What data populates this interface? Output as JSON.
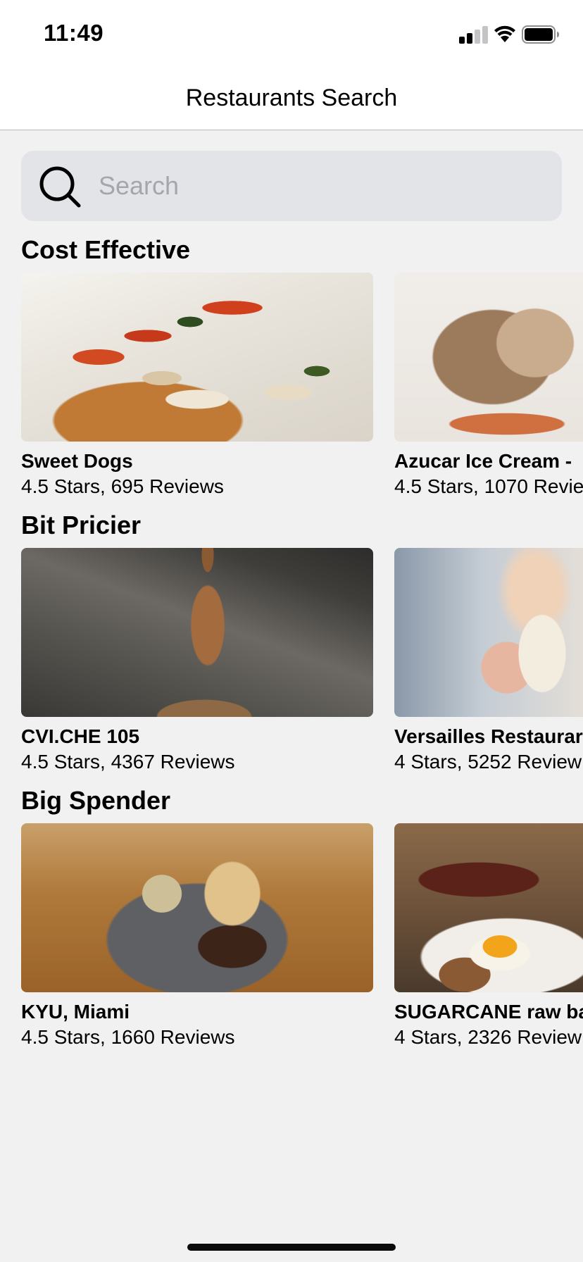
{
  "status_bar": {
    "time": "11:49",
    "icons": [
      "signal-icon",
      "wifi-icon",
      "battery-icon"
    ]
  },
  "nav": {
    "title": "Restaurants Search"
  },
  "search": {
    "placeholder": "Search",
    "value": "",
    "icon": "search-icon"
  },
  "sections": [
    {
      "title": "Cost Effective",
      "cards": [
        {
          "name": "Sweet Dogs",
          "meta": "4.5 Stars, 695 Reviews"
        },
        {
          "name": "Azucar Ice Cream -",
          "meta": "4.5 Stars, 1070 Revie"
        }
      ]
    },
    {
      "title": "Bit Pricier",
      "cards": [
        {
          "name": "CVI.CHE 105",
          "meta": "4.5 Stars, 4367 Reviews"
        },
        {
          "name": "Versailles Restaurar",
          "meta": "4 Stars, 5252 Review"
        }
      ]
    },
    {
      "title": "Big Spender",
      "cards": [
        {
          "name": "KYU, Miami",
          "meta": "4.5 Stars, 1660 Reviews"
        },
        {
          "name": "SUGARCANE raw ba",
          "meta": "4 Stars, 2326 Review"
        }
      ]
    }
  ],
  "colors": {
    "background": "#f1f1f2",
    "search_field": "#e2e4e8",
    "placeholder": "#a3a6ad",
    "text": "#000000"
  }
}
